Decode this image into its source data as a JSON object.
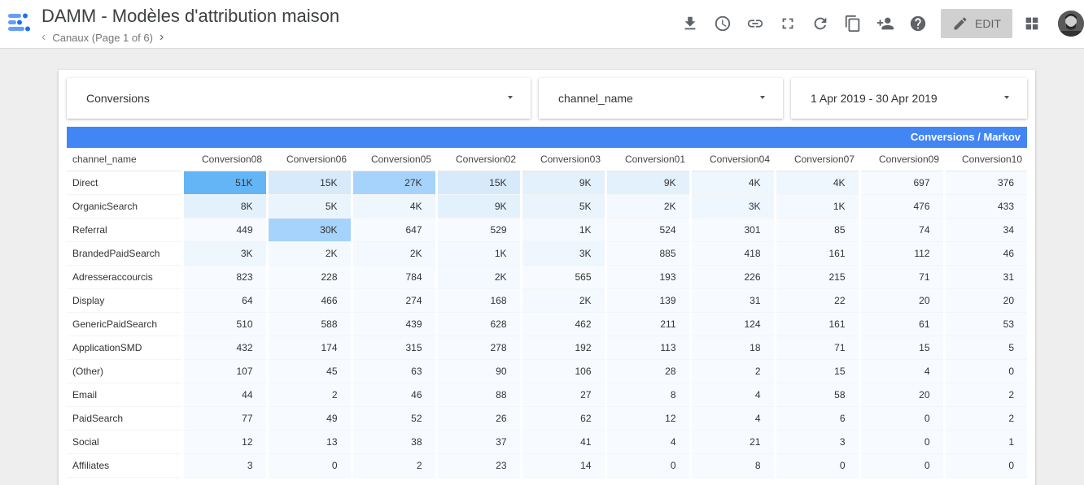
{
  "header": {
    "title": "DAMM - Modèles d'attribution maison",
    "page_name": "Canaux (Page 1 of 6)",
    "edit_label": "EDIT",
    "icons": [
      "download-icon",
      "history-icon",
      "link-icon",
      "fullscreen-icon",
      "refresh-icon",
      "copy-icon",
      "share-icon",
      "help-icon",
      "edit-pencil-icon",
      "apps-grid-icon"
    ]
  },
  "controls": {
    "metric": "Conversions",
    "dimension": "channel_name",
    "date_range": "1 Apr 2019 - 30 Apr 2019"
  },
  "table": {
    "title": "Conversions / Markov",
    "accent_color": "#4285f4",
    "row_header": "channel_name",
    "columns": [
      "Conversion08",
      "Conversion06",
      "Conversion05",
      "Conversion02",
      "Conversion03",
      "Conversion01",
      "Conversion04",
      "Conversion07",
      "Conversion09",
      "Conversion10"
    ],
    "rows": [
      {
        "label": "Direct",
        "values": [
          "51K",
          "15K",
          "27K",
          "15K",
          "9K",
          "9K",
          "4K",
          "4K",
          "697",
          "376"
        ]
      },
      {
        "label": "OrganicSearch",
        "values": [
          "8K",
          "5K",
          "4K",
          "9K",
          "5K",
          "2K",
          "3K",
          "1K",
          "476",
          "433"
        ]
      },
      {
        "label": "Referral",
        "values": [
          "449",
          "30K",
          "647",
          "529",
          "1K",
          "524",
          "301",
          "85",
          "74",
          "34"
        ]
      },
      {
        "label": "BrandedPaidSearch",
        "values": [
          "3K",
          "2K",
          "2K",
          "1K",
          "3K",
          "885",
          "418",
          "161",
          "112",
          "46"
        ]
      },
      {
        "label": "Adresseraccourcis",
        "values": [
          "823",
          "228",
          "784",
          "2K",
          "565",
          "193",
          "226",
          "215",
          "71",
          "31"
        ]
      },
      {
        "label": "Display",
        "values": [
          "64",
          "466",
          "274",
          "168",
          "2K",
          "139",
          "31",
          "22",
          "20",
          "20"
        ]
      },
      {
        "label": "GenericPaidSearch",
        "values": [
          "510",
          "588",
          "439",
          "628",
          "462",
          "211",
          "124",
          "161",
          "61",
          "53"
        ]
      },
      {
        "label": "ApplicationSMD",
        "values": [
          "432",
          "174",
          "315",
          "278",
          "192",
          "113",
          "18",
          "71",
          "15",
          "5"
        ]
      },
      {
        "label": "(Other)",
        "values": [
          "107",
          "45",
          "63",
          "90",
          "106",
          "28",
          "2",
          "15",
          "4",
          "0"
        ]
      },
      {
        "label": "Email",
        "values": [
          "44",
          "2",
          "46",
          "88",
          "27",
          "8",
          "4",
          "58",
          "20",
          "2"
        ]
      },
      {
        "label": "PaidSearch",
        "values": [
          "77",
          "49",
          "52",
          "26",
          "62",
          "12",
          "4",
          "6",
          "0",
          "2"
        ]
      },
      {
        "label": "Social",
        "values": [
          "12",
          "13",
          "38",
          "37",
          "41",
          "4",
          "21",
          "3",
          "0",
          "1"
        ]
      },
      {
        "label": "Affiliates",
        "values": [
          "3",
          "0",
          "2",
          "23",
          "14",
          "0",
          "8",
          "0",
          "0",
          "0"
        ]
      }
    ],
    "heat_colors": [
      [
        "#64b5f6",
        "#d6eafc",
        "#a5d3fb",
        "#d6eafc",
        "#e3f1fd",
        "#e3f1fd",
        "#eef6fe",
        "#eef6fe",
        "#f7fbff",
        "#f7fbff"
      ],
      [
        "#e3f1fd",
        "#eaf4fd",
        "#eef6fe",
        "#e3f1fd",
        "#eaf4fd",
        "#f3f9fe",
        "#eef6fe",
        "#f3f9fe",
        "#f7fbff",
        "#f7fbff"
      ],
      [
        "#f7fbff",
        "#a5d3fb",
        "#f7fbff",
        "#f7fbff",
        "#f3f9fe",
        "#f7fbff",
        "#f7fbff",
        "#f7fbff",
        "#f7fbff",
        "#f7fbff"
      ],
      [
        "#eef6fe",
        "#f3f9fe",
        "#f3f9fe",
        "#f3f9fe",
        "#eef6fe",
        "#f7fbff",
        "#f7fbff",
        "#f7fbff",
        "#f7fbff",
        "#f7fbff"
      ],
      [
        "#f7fbff",
        "#f7fbff",
        "#f7fbff",
        "#f3f9fe",
        "#f7fbff",
        "#f7fbff",
        "#f7fbff",
        "#f7fbff",
        "#f7fbff",
        "#f7fbff"
      ],
      [
        "#f7fbff",
        "#f7fbff",
        "#f7fbff",
        "#f7fbff",
        "#f3f9fe",
        "#f7fbff",
        "#f7fbff",
        "#f7fbff",
        "#f7fbff",
        "#f7fbff"
      ],
      [
        "#f7fbff",
        "#f7fbff",
        "#f7fbff",
        "#f7fbff",
        "#f7fbff",
        "#f7fbff",
        "#f7fbff",
        "#f7fbff",
        "#f7fbff",
        "#f7fbff"
      ],
      [
        "#f7fbff",
        "#f7fbff",
        "#f7fbff",
        "#f7fbff",
        "#f7fbff",
        "#f7fbff",
        "#f7fbff",
        "#f7fbff",
        "#f7fbff",
        "#f7fbff"
      ],
      [
        "#f7fbff",
        "#f7fbff",
        "#f7fbff",
        "#f7fbff",
        "#f7fbff",
        "#f7fbff",
        "#f7fbff",
        "#f7fbff",
        "#f7fbff",
        "#f7fbff"
      ],
      [
        "#f7fbff",
        "#f7fbff",
        "#f7fbff",
        "#f7fbff",
        "#f7fbff",
        "#f7fbff",
        "#f7fbff",
        "#f7fbff",
        "#f7fbff",
        "#f7fbff"
      ],
      [
        "#f7fbff",
        "#f7fbff",
        "#f7fbff",
        "#f7fbff",
        "#f7fbff",
        "#f7fbff",
        "#f7fbff",
        "#f7fbff",
        "#f7fbff",
        "#f7fbff"
      ],
      [
        "#f7fbff",
        "#f7fbff",
        "#f7fbff",
        "#f7fbff",
        "#f7fbff",
        "#f7fbff",
        "#f7fbff",
        "#f7fbff",
        "#f7fbff",
        "#f7fbff"
      ],
      [
        "#f7fbff",
        "#f7fbff",
        "#f7fbff",
        "#f7fbff",
        "#f7fbff",
        "#f7fbff",
        "#f7fbff",
        "#f7fbff",
        "#f7fbff",
        "#f7fbff"
      ]
    ]
  }
}
